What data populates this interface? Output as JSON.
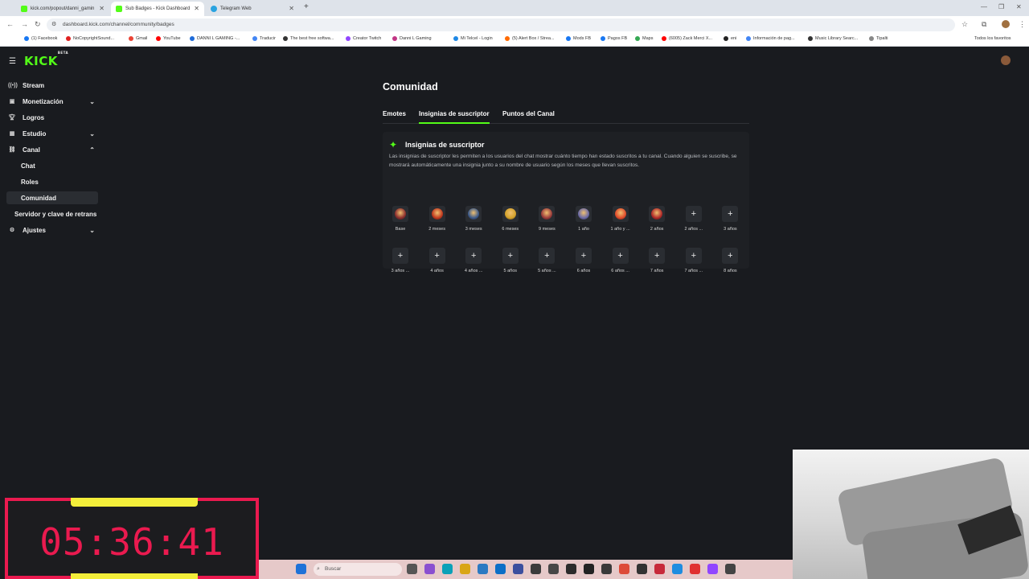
{
  "browser": {
    "tabs": [
      {
        "title": "kick.com/popout/danni_gamin",
        "active": false
      },
      {
        "title": "Sub Badges - Kick Dashboard",
        "active": true
      },
      {
        "title": "Telegram Web",
        "active": false
      }
    ],
    "url": "dashboard.kick.com/channel/community/badges",
    "bookmarks": [
      "(1) Facebook",
      "NoCopyrightSound...",
      "Gmail",
      "YouTube",
      "DANNI L GAMING -...",
      "Traducir",
      "The best free softwa...",
      "Creator Twitch",
      "Danni L Gaming",
      "Mi Telcel - Login",
      "(5) Alert Box / Strea...",
      "Mods FB",
      "Pagos FB",
      "Maps",
      "(6005) Zack Merci X...",
      "eni",
      "Información de pag...",
      "Music Library Searc...",
      "Tipalti"
    ],
    "bookmarks_right": "Todos los favoritos"
  },
  "sidebar": {
    "items": [
      {
        "label": "Stream",
        "icon": "broadcast-icon",
        "chevron": ""
      },
      {
        "label": "Monetización",
        "icon": "money-icon",
        "chevron": "⌄"
      },
      {
        "label": "Logros",
        "icon": "trophy-icon",
        "chevron": ""
      },
      {
        "label": "Estudio",
        "icon": "studio-icon",
        "chevron": "⌄"
      },
      {
        "label": "Canal",
        "icon": "channel-icon",
        "chevron": "⌃"
      }
    ],
    "sub_items": [
      "Chat",
      "Roles",
      "Comunidad"
    ],
    "extra": "Servidor y clave de retrans",
    "settings": {
      "label": "Ajustes",
      "icon": "gear-icon",
      "chevron": "⌄"
    }
  },
  "main": {
    "title": "Comunidad",
    "tabs": [
      "Emotes",
      "Insignias de suscriptor",
      "Puntos del Canal"
    ],
    "active_tab": "Insignias de suscriptor",
    "card": {
      "title": "Insignias de suscriptor",
      "description": "Las insignias de suscriptor les permiten a los usuarios del chat mostrar cuánto tiempo han estado suscritos a tu canal. Cuando alguien se suscribe, se mostrará automáticamente una insignia junto a su nombre de usuario según los meses que llevan suscritos."
    },
    "badges_row1": [
      {
        "label": "Base",
        "type": "art",
        "color": "#8b2e2e"
      },
      {
        "label": "2 meses",
        "type": "art",
        "color": "#c0381e"
      },
      {
        "label": "3 meses",
        "type": "art",
        "color": "#3a5a8c"
      },
      {
        "label": "6 meses",
        "type": "art",
        "color": "#d4a22a"
      },
      {
        "label": "9 meses",
        "type": "art",
        "color": "#9a3b3b"
      },
      {
        "label": "1 año",
        "type": "art",
        "color": "#6a6aa8"
      },
      {
        "label": "1 año y ...",
        "type": "art",
        "color": "#e04a2a"
      },
      {
        "label": "2 años",
        "type": "art",
        "color": "#b02828"
      },
      {
        "label": "2 años ...",
        "type": "add"
      },
      {
        "label": "3 años",
        "type": "add"
      }
    ],
    "badges_row2": [
      {
        "label": "3 años ...",
        "type": "add"
      },
      {
        "label": "4 años",
        "type": "add"
      },
      {
        "label": "4 años ...",
        "type": "add"
      },
      {
        "label": "5 años",
        "type": "add"
      },
      {
        "label": "5 años ...",
        "type": "add"
      },
      {
        "label": "6 años",
        "type": "add"
      },
      {
        "label": "6 años ...",
        "type": "add"
      },
      {
        "label": "7 años",
        "type": "add"
      },
      {
        "label": "7 años ...",
        "type": "add"
      },
      {
        "label": "8 años",
        "type": "add"
      }
    ]
  },
  "overlay": {
    "timer": "05:36:41"
  },
  "taskbar": {
    "search_placeholder": "Buscar"
  },
  "colors": {
    "accent": "#53fc18",
    "background": "#191b1f",
    "timer": "#ea1a4f",
    "timer_bar": "#f3ee3a"
  }
}
